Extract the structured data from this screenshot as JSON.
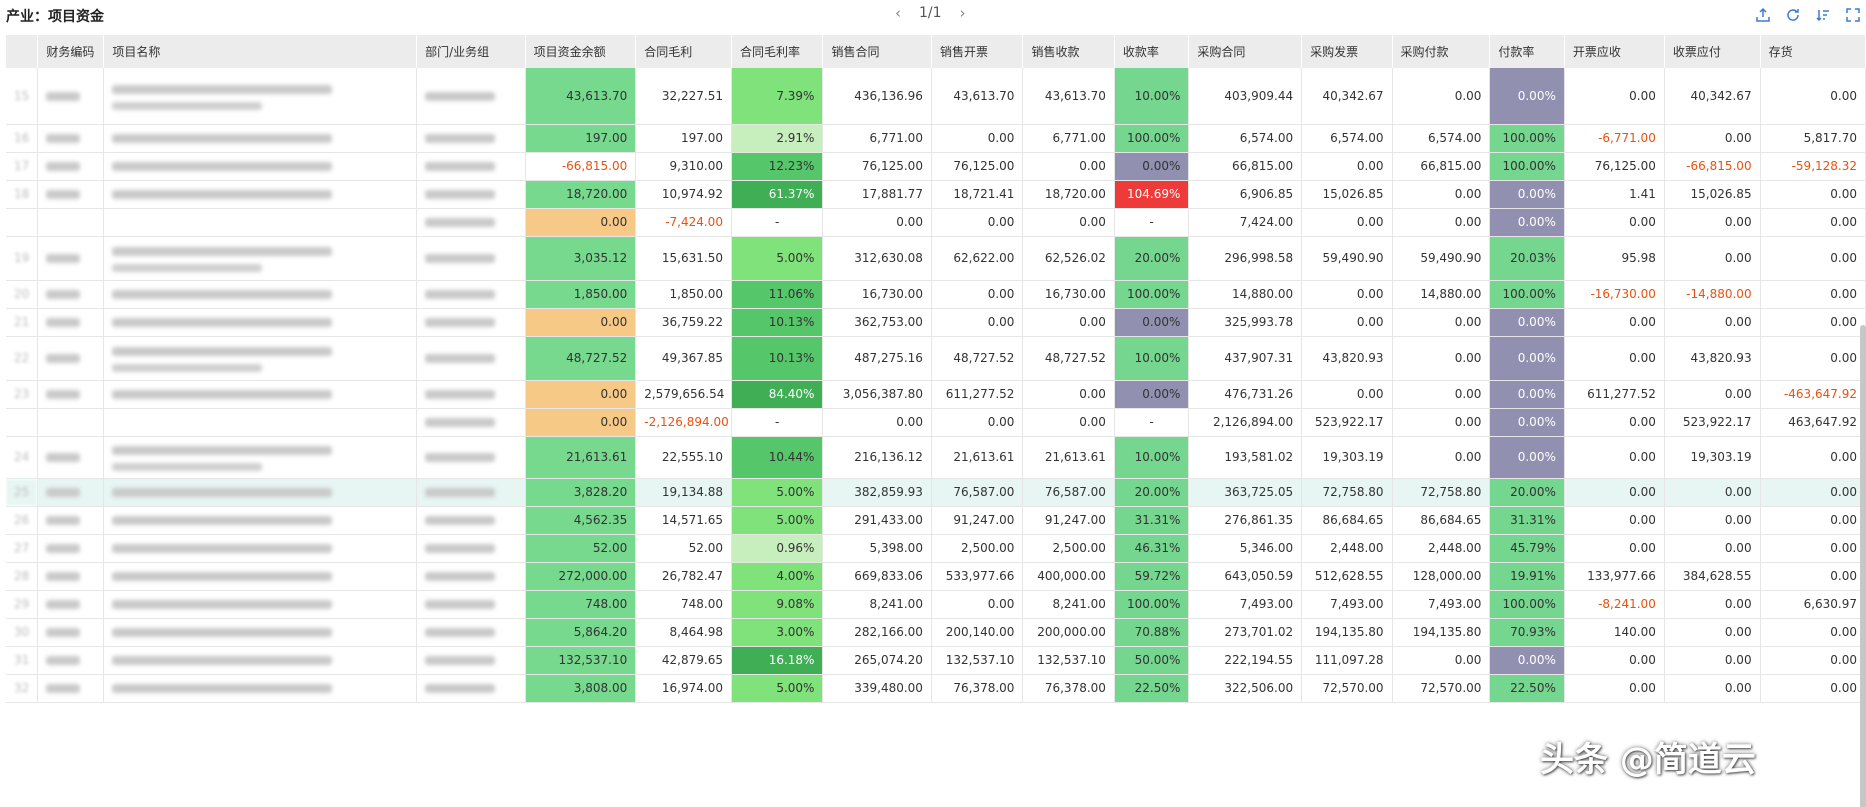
{
  "header": {
    "title": "产业：项目资金",
    "page_indicator": "1/1",
    "prev_icon": "chevron-left-icon",
    "next_icon": "chevron-right-icon",
    "tools": [
      "export-icon",
      "refresh-icon",
      "sort-icon",
      "expand-icon"
    ]
  },
  "table": {
    "columns": [
      "财务编码",
      "项目名称",
      "部门/业务组",
      "项目资金余额",
      "合同毛利",
      "合同毛利率",
      "销售合同",
      "销售开票",
      "销售收款",
      "收款率",
      "采购合同",
      "采购发票",
      "采购付款",
      "付款率",
      "开票应收",
      "收票应付",
      "存货"
    ],
    "rows": [
      {
        "idx": "15",
        "h": 56,
        "vals": [
          "43,613.70",
          "32,227.51",
          "7.39%",
          "436,136.96",
          "43,613.70",
          "43,613.70",
          "10.00%",
          "403,909.44",
          "40,342.67",
          "0.00",
          "0.00%",
          "0.00",
          "40,342.67",
          "0.00"
        ]
      },
      {
        "idx": "16",
        "h": 28,
        "vals": [
          "197.00",
          "197.00",
          "2.91%",
          "6,771.00",
          "0.00",
          "6,771.00",
          "100.00%",
          "6,574.00",
          "6,574.00",
          "6,574.00",
          "100.00%",
          "-6,771.00",
          "0.00",
          "5,817.70"
        ]
      },
      {
        "idx": "17",
        "h": 28,
        "vals": [
          "-66,815.00",
          "9,310.00",
          "12.23%",
          "76,125.00",
          "76,125.00",
          "0.00",
          "0.00%",
          "66,815.00",
          "0.00",
          "66,815.00",
          "100.00%",
          "76,125.00",
          "-66,815.00",
          "-59,128.32"
        ]
      },
      {
        "idx": "18",
        "h": 28,
        "vals": [
          "18,720.00",
          "10,974.92",
          "61.37%",
          "17,881.77",
          "18,721.41",
          "18,720.00",
          "104.69%",
          "6,906.85",
          "15,026.85",
          "0.00",
          "0.00%",
          "1.41",
          "15,026.85",
          "0.00"
        ]
      },
      {
        "idx": "",
        "h": 28,
        "vals": [
          "0.00",
          "-7,424.00",
          "-",
          "0.00",
          "0.00",
          "0.00",
          "-",
          "7,424.00",
          "0.00",
          "0.00",
          "0.00%",
          "0.00",
          "0.00",
          "0.00"
        ]
      },
      {
        "idx": "19",
        "h": 44,
        "vals": [
          "3,035.12",
          "15,631.50",
          "5.00%",
          "312,630.08",
          "62,622.00",
          "62,526.02",
          "20.00%",
          "296,998.58",
          "59,490.90",
          "59,490.90",
          "20.03%",
          "95.98",
          "0.00",
          "0.00"
        ]
      },
      {
        "idx": "20",
        "h": 28,
        "vals": [
          "1,850.00",
          "1,850.00",
          "11.06%",
          "16,730.00",
          "0.00",
          "16,730.00",
          "100.00%",
          "14,880.00",
          "0.00",
          "14,880.00",
          "100.00%",
          "-16,730.00",
          "-14,880.00",
          "0.00"
        ]
      },
      {
        "idx": "21",
        "h": 28,
        "vals": [
          "0.00",
          "36,759.22",
          "10.13%",
          "362,753.00",
          "0.00",
          "0.00",
          "0.00%",
          "325,993.78",
          "0.00",
          "0.00",
          "0.00%",
          "0.00",
          "0.00",
          "0.00"
        ]
      },
      {
        "idx": "22",
        "h": 44,
        "vals": [
          "48,727.52",
          "49,367.85",
          "10.13%",
          "487,275.16",
          "48,727.52",
          "48,727.52",
          "10.00%",
          "437,907.31",
          "43,820.93",
          "0.00",
          "0.00%",
          "0.00",
          "43,820.93",
          "0.00"
        ]
      },
      {
        "idx": "23",
        "h": 28,
        "vals": [
          "0.00",
          "2,579,656.54",
          "84.40%",
          "3,056,387.80",
          "611,277.52",
          "0.00",
          "0.00%",
          "476,731.26",
          "0.00",
          "0.00",
          "0.00%",
          "611,277.52",
          "0.00",
          "-463,647.92"
        ]
      },
      {
        "idx": "",
        "h": 28,
        "vals": [
          "0.00",
          "-2,126,894.00",
          "-",
          "0.00",
          "0.00",
          "0.00",
          "-",
          "2,126,894.00",
          "523,922.17",
          "0.00",
          "0.00%",
          "0.00",
          "523,922.17",
          "463,647.92"
        ]
      },
      {
        "idx": "24",
        "h": 42,
        "vals": [
          "21,613.61",
          "22,555.10",
          "10.44%",
          "216,136.12",
          "21,613.61",
          "21,613.61",
          "10.00%",
          "193,581.02",
          "19,303.19",
          "0.00",
          "0.00%",
          "0.00",
          "19,303.19",
          "0.00"
        ]
      },
      {
        "idx": "25",
        "h": 28,
        "hl": true,
        "vals": [
          "3,828.20",
          "19,134.88",
          "5.00%",
          "382,859.93",
          "76,587.00",
          "76,587.00",
          "20.00%",
          "363,725.05",
          "72,758.80",
          "72,758.80",
          "20.00%",
          "0.00",
          "0.00",
          "0.00"
        ]
      },
      {
        "idx": "26",
        "h": 28,
        "vals": [
          "4,562.35",
          "14,571.65",
          "5.00%",
          "291,433.00",
          "91,247.00",
          "91,247.00",
          "31.31%",
          "276,861.35",
          "86,684.65",
          "86,684.65",
          "31.31%",
          "0.00",
          "0.00",
          "0.00"
        ]
      },
      {
        "idx": "27",
        "h": 28,
        "vals": [
          "52.00",
          "52.00",
          "0.96%",
          "5,398.00",
          "2,500.00",
          "2,500.00",
          "46.31%",
          "5,346.00",
          "2,448.00",
          "2,448.00",
          "45.79%",
          "0.00",
          "0.00",
          "0.00"
        ]
      },
      {
        "idx": "28",
        "h": 28,
        "vals": [
          "272,000.00",
          "26,782.47",
          "4.00%",
          "669,833.06",
          "533,977.66",
          "400,000.00",
          "59.72%",
          "643,050.59",
          "512,628.55",
          "128,000.00",
          "19.91%",
          "133,977.66",
          "384,628.55",
          "0.00"
        ]
      },
      {
        "idx": "29",
        "h": 28,
        "vals": [
          "748.00",
          "748.00",
          "9.08%",
          "8,241.00",
          "0.00",
          "8,241.00",
          "100.00%",
          "7,493.00",
          "7,493.00",
          "7,493.00",
          "100.00%",
          "-8,241.00",
          "0.00",
          "6,630.97"
        ]
      },
      {
        "idx": "30",
        "h": 28,
        "vals": [
          "5,864.20",
          "8,464.98",
          "3.00%",
          "282,166.00",
          "200,140.00",
          "200,000.00",
          "70.88%",
          "273,701.02",
          "194,135.80",
          "194,135.80",
          "70.93%",
          "140.00",
          "0.00",
          "0.00"
        ]
      },
      {
        "idx": "31",
        "h": 28,
        "vals": [
          "132,537.10",
          "42,879.65",
          "16.18%",
          "265,074.20",
          "132,537.10",
          "132,537.10",
          "50.00%",
          "222,194.55",
          "111,097.28",
          "0.00",
          "0.00%",
          "0.00",
          "0.00",
          "0.00"
        ]
      },
      {
        "idx": "32",
        "h": 28,
        "vals": [
          "3,808.00",
          "16,974.00",
          "5.00%",
          "339,480.00",
          "76,378.00",
          "76,378.00",
          "22.50%",
          "322,506.00",
          "72,570.00",
          "72,570.00",
          "22.50%",
          "0.00",
          "0.00",
          "0.00"
        ]
      }
    ]
  },
  "colors": {
    "balance_positive": "#76d98e",
    "balance_zero": "#f7c987",
    "margin_dark": "#3fae55",
    "margin_mid": "#55c66a",
    "margin_light": "#7fe27a",
    "margin_pale": "#c7efbe",
    "rate_paid": "#75d68f",
    "rate_zero": "#9290b0",
    "rate_over": "#ef3a3a",
    "negative_text": "#e8520f"
  },
  "watermark": "头条 @简道云"
}
